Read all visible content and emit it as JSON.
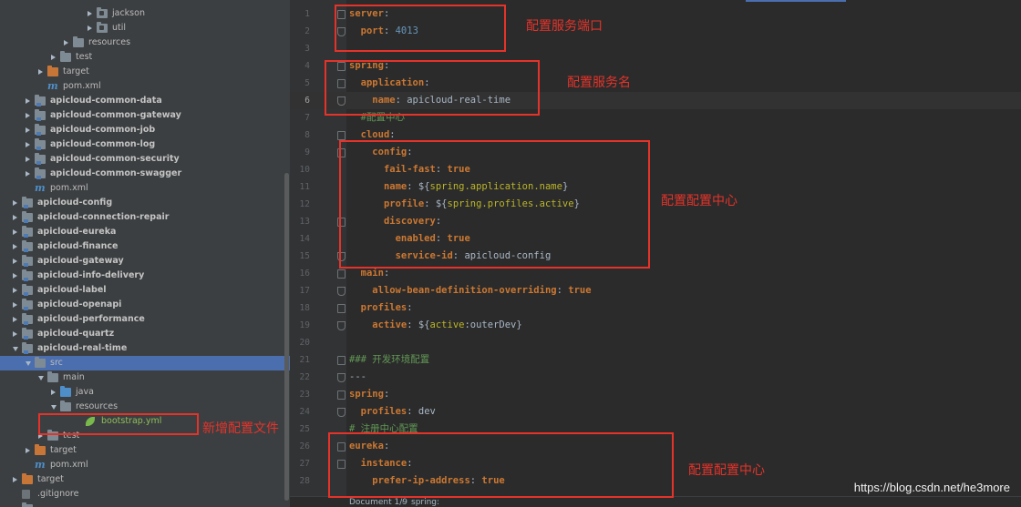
{
  "tree": {
    "rows": [
      {
        "label": "jackson",
        "type": "pkg",
        "indent": 96,
        "expanded": false,
        "bold": false
      },
      {
        "label": "util",
        "type": "pkg",
        "indent": 96,
        "expanded": false,
        "bold": false
      },
      {
        "label": "resources",
        "type": "folder",
        "indent": 70,
        "expanded": false,
        "bold": false
      },
      {
        "label": "test",
        "type": "folder",
        "indent": 56,
        "expanded": false,
        "bold": false
      },
      {
        "label": "target",
        "type": "orange",
        "indent": 42,
        "expanded": false,
        "bold": false
      },
      {
        "label": "pom.xml",
        "type": "maven",
        "indent": 42,
        "expanded": null,
        "bold": false
      },
      {
        "label": "apicloud-common-data",
        "type": "module",
        "indent": 28,
        "expanded": false,
        "bold": true
      },
      {
        "label": "apicloud-common-gateway",
        "type": "module",
        "indent": 28,
        "expanded": false,
        "bold": true
      },
      {
        "label": "apicloud-common-job",
        "type": "module",
        "indent": 28,
        "expanded": false,
        "bold": true
      },
      {
        "label": "apicloud-common-log",
        "type": "module",
        "indent": 28,
        "expanded": false,
        "bold": true
      },
      {
        "label": "apicloud-common-security",
        "type": "module",
        "indent": 28,
        "expanded": false,
        "bold": true
      },
      {
        "label": "apicloud-common-swagger",
        "type": "module",
        "indent": 28,
        "expanded": false,
        "bold": true
      },
      {
        "label": "pom.xml",
        "type": "maven",
        "indent": 28,
        "expanded": null,
        "bold": false
      },
      {
        "label": "apicloud-config",
        "type": "module",
        "indent": 14,
        "expanded": false,
        "bold": true
      },
      {
        "label": "apicloud-connection-repair",
        "type": "module",
        "indent": 14,
        "expanded": false,
        "bold": true
      },
      {
        "label": "apicloud-eureka",
        "type": "module",
        "indent": 14,
        "expanded": false,
        "bold": true
      },
      {
        "label": "apicloud-finance",
        "type": "module",
        "indent": 14,
        "expanded": false,
        "bold": true
      },
      {
        "label": "apicloud-gateway",
        "type": "module",
        "indent": 14,
        "expanded": false,
        "bold": true
      },
      {
        "label": "apicloud-info-delivery",
        "type": "module",
        "indent": 14,
        "expanded": false,
        "bold": true
      },
      {
        "label": "apicloud-label",
        "type": "module",
        "indent": 14,
        "expanded": false,
        "bold": true
      },
      {
        "label": "apicloud-openapi",
        "type": "module",
        "indent": 14,
        "expanded": false,
        "bold": true
      },
      {
        "label": "apicloud-performance",
        "type": "module",
        "indent": 14,
        "expanded": false,
        "bold": true
      },
      {
        "label": "apicloud-quartz",
        "type": "module",
        "indent": 14,
        "expanded": false,
        "bold": true
      },
      {
        "label": "apicloud-real-time",
        "type": "module",
        "indent": 14,
        "expanded": true,
        "bold": true
      },
      {
        "label": "src",
        "type": "folder",
        "indent": 28,
        "expanded": true,
        "bold": false,
        "selected": true
      },
      {
        "label": "main",
        "type": "folder",
        "indent": 42,
        "expanded": true,
        "bold": false
      },
      {
        "label": "java",
        "type": "src",
        "indent": 56,
        "expanded": false,
        "bold": false
      },
      {
        "label": "resources",
        "type": "folder",
        "indent": 56,
        "expanded": true,
        "bold": false
      },
      {
        "label": "bootstrap.yml",
        "type": "yml",
        "indent": 84,
        "expanded": null,
        "bold": false
      },
      {
        "label": "test",
        "type": "folder",
        "indent": 42,
        "expanded": false,
        "bold": false
      },
      {
        "label": "target",
        "type": "orange",
        "indent": 28,
        "expanded": false,
        "bold": false
      },
      {
        "label": "pom.xml",
        "type": "maven",
        "indent": 28,
        "expanded": null,
        "bold": false
      },
      {
        "label": "target",
        "type": "orange",
        "indent": 14,
        "expanded": false,
        "bold": false
      },
      {
        "label": ".gitignore",
        "type": "git",
        "indent": 14,
        "expanded": null,
        "bold": false
      },
      {
        "label": "",
        "type": "folder",
        "indent": 14,
        "expanded": null,
        "bold": false
      }
    ]
  },
  "editor": {
    "current_line": 6,
    "lines": [
      {
        "n": "1",
        "fold": "start",
        "tokens": [
          [
            "k",
            "server"
          ],
          [
            "v",
            ":"
          ]
        ]
      },
      {
        "n": "2",
        "fold": "end",
        "tokens": [
          [
            "v",
            "  "
          ],
          [
            "k",
            "port"
          ],
          [
            "v",
            ": "
          ],
          [
            "n",
            "4013"
          ]
        ]
      },
      {
        "n": "3",
        "fold": "",
        "tokens": []
      },
      {
        "n": "4",
        "fold": "start",
        "tokens": [
          [
            "k",
            "spring"
          ],
          [
            "v",
            ":"
          ]
        ]
      },
      {
        "n": "5",
        "fold": "start",
        "tokens": [
          [
            "v",
            "  "
          ],
          [
            "k",
            "application"
          ],
          [
            "v",
            ":"
          ]
        ]
      },
      {
        "n": "6",
        "fold": "end",
        "tokens": [
          [
            "v",
            "    "
          ],
          [
            "k",
            "name"
          ],
          [
            "v",
            ": apicloud-real-time"
          ]
        ]
      },
      {
        "n": "7",
        "fold": "",
        "tokens": [
          [
            "c",
            "  #配置中心"
          ]
        ]
      },
      {
        "n": "8",
        "fold": "start",
        "tokens": [
          [
            "v",
            "  "
          ],
          [
            "k",
            "cloud"
          ],
          [
            "v",
            ":"
          ]
        ]
      },
      {
        "n": "9",
        "fold": "start",
        "tokens": [
          [
            "v",
            "    "
          ],
          [
            "k",
            "config"
          ],
          [
            "v",
            ":"
          ]
        ]
      },
      {
        "n": "10",
        "fold": "",
        "tokens": [
          [
            "v",
            "      "
          ],
          [
            "k",
            "fail-fast"
          ],
          [
            "v",
            ": "
          ],
          [
            "vb",
            "true"
          ]
        ]
      },
      {
        "n": "11",
        "fold": "",
        "tokens": [
          [
            "v",
            "      "
          ],
          [
            "k",
            "name"
          ],
          [
            "v",
            ": ${"
          ],
          [
            "mk",
            "spring.application.name"
          ],
          [
            "v",
            "}"
          ]
        ]
      },
      {
        "n": "12",
        "fold": "",
        "tokens": [
          [
            "v",
            "      "
          ],
          [
            "k",
            "profile"
          ],
          [
            "v",
            ": ${"
          ],
          [
            "mk",
            "spring.profiles.active"
          ],
          [
            "v",
            "}"
          ]
        ]
      },
      {
        "n": "13",
        "fold": "start",
        "tokens": [
          [
            "v",
            "      "
          ],
          [
            "k",
            "discovery"
          ],
          [
            "v",
            ":"
          ]
        ]
      },
      {
        "n": "14",
        "fold": "",
        "tokens": [
          [
            "v",
            "        "
          ],
          [
            "k",
            "enabled"
          ],
          [
            "v",
            ": "
          ],
          [
            "vb",
            "true"
          ]
        ]
      },
      {
        "n": "15",
        "fold": "end",
        "tokens": [
          [
            "v",
            "        "
          ],
          [
            "k",
            "service-id"
          ],
          [
            "v",
            ": apicloud-config"
          ]
        ]
      },
      {
        "n": "16",
        "fold": "start",
        "tokens": [
          [
            "v",
            "  "
          ],
          [
            "k",
            "main"
          ],
          [
            "v",
            ":"
          ]
        ]
      },
      {
        "n": "17",
        "fold": "end",
        "tokens": [
          [
            "v",
            "    "
          ],
          [
            "k",
            "allow-bean-definition-overriding"
          ],
          [
            "v",
            ": "
          ],
          [
            "vb",
            "true"
          ]
        ]
      },
      {
        "n": "18",
        "fold": "start",
        "tokens": [
          [
            "v",
            "  "
          ],
          [
            "k",
            "profiles"
          ],
          [
            "v",
            ":"
          ]
        ]
      },
      {
        "n": "19",
        "fold": "end",
        "tokens": [
          [
            "v",
            "    "
          ],
          [
            "k",
            "active"
          ],
          [
            "v",
            ": ${"
          ],
          [
            "mk",
            "active"
          ],
          [
            "v",
            ":outerDev}"
          ]
        ]
      },
      {
        "n": "20",
        "fold": "",
        "tokens": []
      },
      {
        "n": "21",
        "fold": "start",
        "tokens": [
          [
            "c",
            "### 开发环境配置"
          ]
        ]
      },
      {
        "n": "22",
        "fold": "end",
        "tokens": [
          [
            "m",
            "---"
          ]
        ]
      },
      {
        "n": "23",
        "fold": "start",
        "tokens": [
          [
            "k",
            "spring"
          ],
          [
            "v",
            ":"
          ]
        ]
      },
      {
        "n": "24",
        "fold": "end",
        "tokens": [
          [
            "v",
            "  "
          ],
          [
            "k",
            "profiles"
          ],
          [
            "v",
            ": dev"
          ]
        ]
      },
      {
        "n": "25",
        "fold": "",
        "tokens": [
          [
            "c",
            "# 注册中心配置"
          ]
        ]
      },
      {
        "n": "26",
        "fold": "start",
        "tokens": [
          [
            "k",
            "eureka"
          ],
          [
            "v",
            ":"
          ]
        ]
      },
      {
        "n": "27",
        "fold": "start",
        "tokens": [
          [
            "v",
            "  "
          ],
          [
            "k",
            "instance"
          ],
          [
            "v",
            ":"
          ]
        ]
      },
      {
        "n": "28",
        "fold": "",
        "tokens": [
          [
            "v",
            "    "
          ],
          [
            "k",
            "prefer-ip-address"
          ],
          [
            "v",
            ": "
          ],
          [
            "vb",
            "true"
          ]
        ]
      }
    ]
  },
  "breadcrumb": {
    "document": "Document 1/9",
    "separator": "›",
    "path": "spring:"
  },
  "annotations": {
    "service_port": "配置服务端口",
    "service_name": "配置服务名",
    "config_center_1": "配置配置中心",
    "config_center_2": "配置配置中心",
    "new_file": "新增配置文件"
  },
  "watermark": "https://blog.csdn.net/he3more",
  "colors": {
    "annotation": "#e5332a",
    "selection": "#4b6eaf",
    "keyword": "#cc7832",
    "number": "#6897bb",
    "comment": "#629755"
  }
}
